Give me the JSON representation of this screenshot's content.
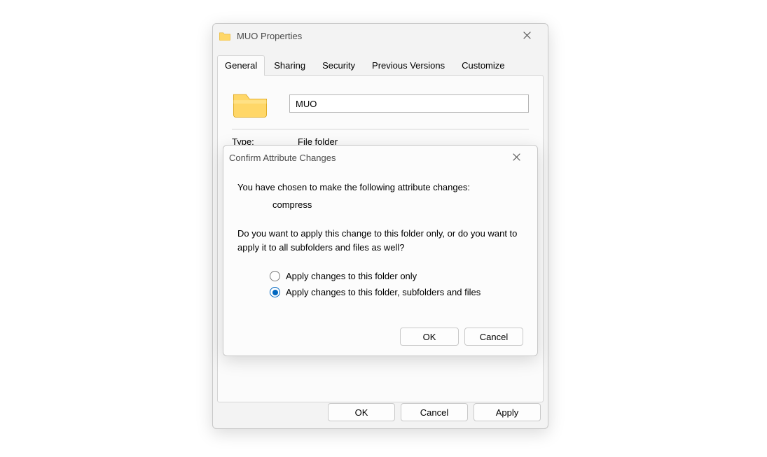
{
  "properties": {
    "window_title": "MUO Properties",
    "tabs": {
      "general": "General",
      "sharing": "Sharing",
      "security": "Security",
      "previous": "Previous Versions",
      "customize": "Customize"
    },
    "name_value": "MUO",
    "type_label": "Type:",
    "type_value": "File folder",
    "buttons": {
      "ok": "OK",
      "cancel": "Cancel",
      "apply": "Apply"
    }
  },
  "confirm": {
    "title": "Confirm Attribute Changes",
    "msg_intro": "You have chosen to make the following attribute changes:",
    "attribute": "compress",
    "msg_question": "Do you want to apply this change to this folder only, or do you want to apply it to all subfolders and files as well?",
    "option_folder_only": "Apply changes to this folder only",
    "option_all": "Apply changes to this folder, subfolders and files",
    "buttons": {
      "ok": "OK",
      "cancel": "Cancel"
    }
  }
}
